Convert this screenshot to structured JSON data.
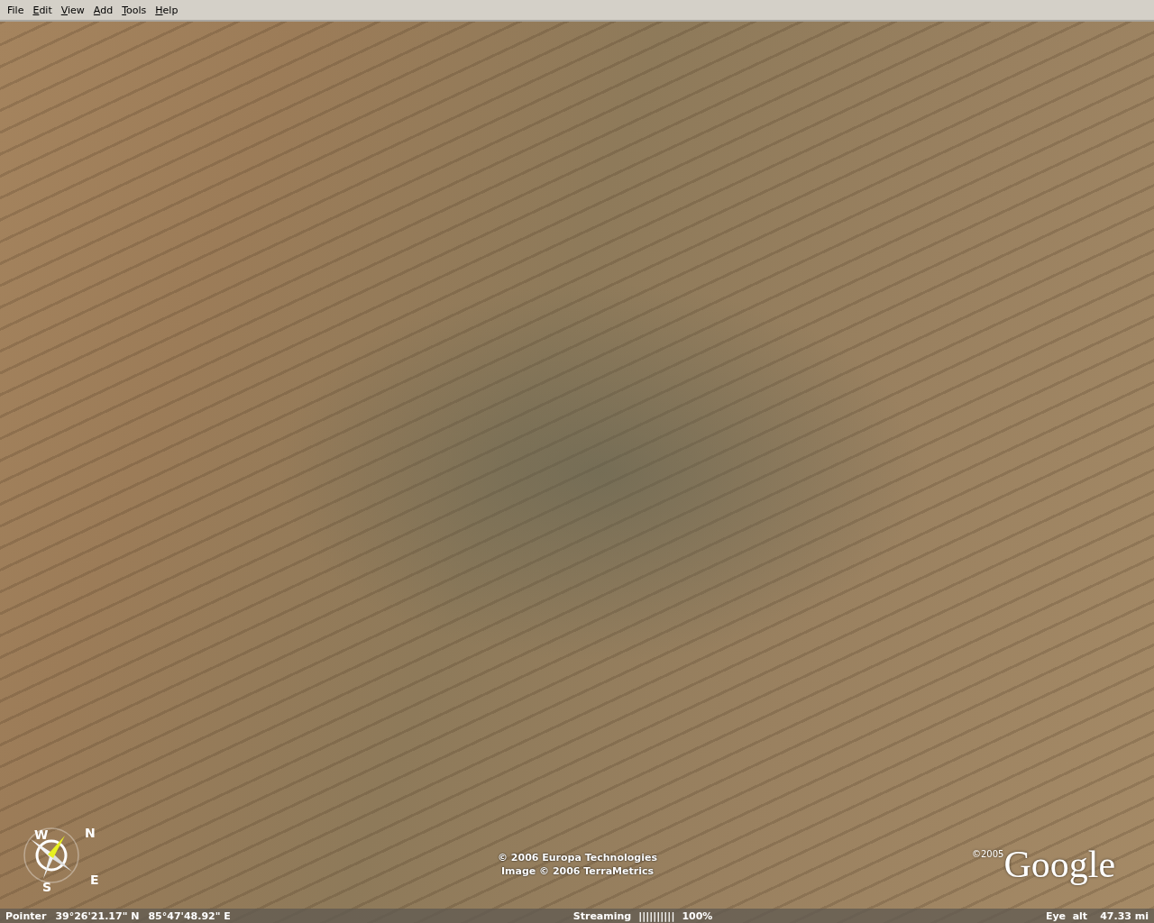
{
  "menu": [
    {
      "label": "File",
      "mnemonic": false
    },
    {
      "label": "Edit",
      "mnemonic": true
    },
    {
      "label": "View",
      "mnemonic": true
    },
    {
      "label": "Add",
      "mnemonic": true
    },
    {
      "label": "Tools",
      "mnemonic": true
    },
    {
      "label": "Help",
      "mnemonic": true
    }
  ],
  "compass": {
    "north": "N",
    "east": "E",
    "south": "S",
    "west": "W"
  },
  "attribution": [
    "© 2006 Europa Technologies",
    "Image © 2006 TerraMetrics"
  ],
  "logo": {
    "copyright": "©2005",
    "wordmark": "Google"
  },
  "status_bar": {
    "pointer": {
      "label": "Pointer",
      "latitude": "39°26'21.17\" N",
      "longitude": "85°47'48.92\" E"
    },
    "streaming": {
      "label": "Streaming",
      "bars": "||||||||||",
      "percent": "100%"
    },
    "eye_alt": {
      "label": "Eye  alt",
      "value": "47.33 mi"
    }
  }
}
